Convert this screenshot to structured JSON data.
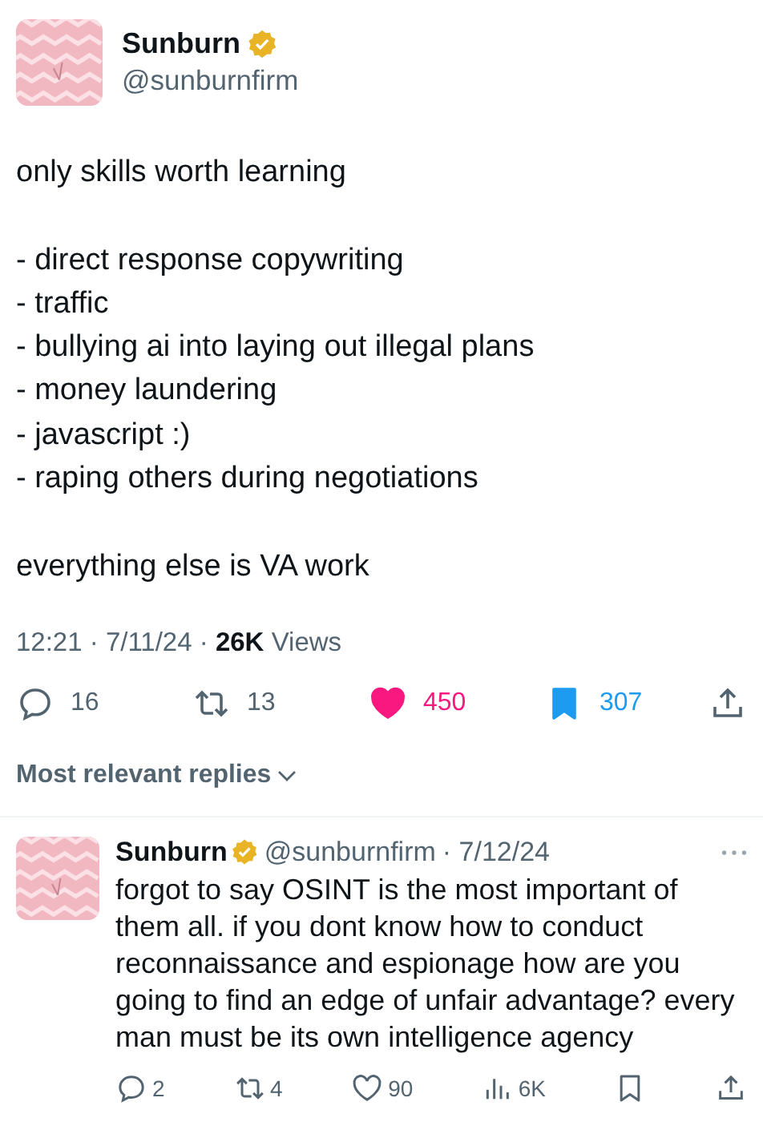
{
  "tweet": {
    "author": {
      "name": "Sunburn",
      "handle": "@sunburnfirm",
      "verified": true
    },
    "paragraphs": [
      [
        "only skills worth learning"
      ],
      [
        "- direct response copywriting",
        "- traffic",
        "- bullying ai into laying out illegal plans",
        "- money laundering",
        "- javascript :)",
        "- raping others during negotiations"
      ],
      [
        "everything else is VA work"
      ]
    ],
    "meta": "12:21 · 7/11/24 · **26K** Views",
    "actions": [
      {
        "kind": "reply",
        "count": "16"
      },
      {
        "kind": "repost",
        "count": "13"
      },
      {
        "kind": "like",
        "count": "450",
        "on": true
      },
      {
        "kind": "bookmark",
        "count": "307",
        "on": true
      },
      {
        "kind": "share"
      }
    ]
  },
  "sort": {
    "label": "Most relevant replies"
  },
  "replies": [
    {
      "author": {
        "name": "Sunburn",
        "handle": "@sunburnfirm",
        "verified": true
      },
      "date": "· 7/12/24",
      "text": "forgot to say OSINT is the most important of them all. if you dont know how to conduct reconnaissance and espionage how are you going to find an edge of unfair advantage? every man must be its own intelligence agency",
      "actions": [
        {
          "kind": "reply",
          "count": "2"
        },
        {
          "kind": "repost",
          "count": "4"
        },
        {
          "kind": "like",
          "count": "90",
          "on": false
        },
        {
          "kind": "views",
          "count": "6K"
        },
        {
          "kind": "bookmark",
          "on": false
        },
        {
          "kind": "share"
        }
      ]
    }
  ]
}
